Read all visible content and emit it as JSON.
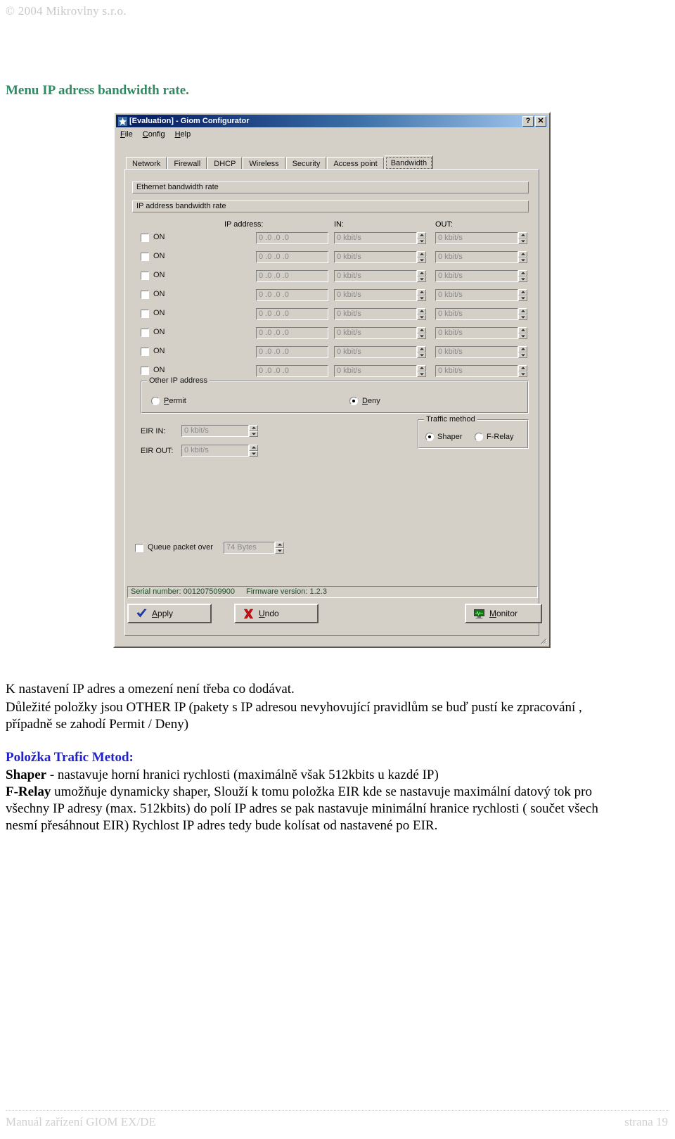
{
  "page": {
    "copyright": "© 2004 Mikrovlny s.r.o.",
    "footer_left": "Manuál zařízení GIOM EX/DE",
    "footer_right": "strana 19",
    "heading": "Menu IP adress bandwidth rate."
  },
  "window": {
    "title": "[Evaluation] - Giom Configurator",
    "icon": "app-icon",
    "help_button": "?",
    "close_button": "✕",
    "menu": [
      {
        "label": "File",
        "mnemonic": "F"
      },
      {
        "label": "Config",
        "mnemonic": "C"
      },
      {
        "label": "Help",
        "mnemonic": "H"
      }
    ],
    "tabs": [
      {
        "label": "Network",
        "selected": false
      },
      {
        "label": "Firewall",
        "selected": false
      },
      {
        "label": "DHCP",
        "selected": false
      },
      {
        "label": "Wireless",
        "selected": false
      },
      {
        "label": "Security",
        "selected": false
      },
      {
        "label": "Access point",
        "selected": false
      },
      {
        "label": "Bandwidth",
        "selected": true
      }
    ],
    "panels": {
      "ethernet_header": "Ethernet bandwidth rate",
      "ip_header": "IP address bandwidth rate"
    },
    "columns": {
      "ip": "IP address:",
      "in": "IN:",
      "out": "OUT:"
    },
    "rows": [
      {
        "enabled_label": "ON",
        "checked": false,
        "ip": "0 .0 .0 .0",
        "in": "0 kbit/s",
        "out": "0 kbit/s"
      },
      {
        "enabled_label": "ON",
        "checked": false,
        "ip": "0 .0 .0 .0",
        "in": "0 kbit/s",
        "out": "0 kbit/s"
      },
      {
        "enabled_label": "ON",
        "checked": false,
        "ip": "0 .0 .0 .0",
        "in": "0 kbit/s",
        "out": "0 kbit/s"
      },
      {
        "enabled_label": "ON",
        "checked": false,
        "ip": "0 .0 .0 .0",
        "in": "0 kbit/s",
        "out": "0 kbit/s"
      },
      {
        "enabled_label": "ON",
        "checked": false,
        "ip": "0 .0 .0 .0",
        "in": "0 kbit/s",
        "out": "0 kbit/s"
      },
      {
        "enabled_label": "ON",
        "checked": false,
        "ip": "0 .0 .0 .0",
        "in": "0 kbit/s",
        "out": "0 kbit/s"
      },
      {
        "enabled_label": "ON",
        "checked": false,
        "ip": "0 .0 .0 .0",
        "in": "0 kbit/s",
        "out": "0 kbit/s"
      },
      {
        "enabled_label": "ON",
        "checked": false,
        "ip": "0 .0 .0 .0",
        "in": "0 kbit/s",
        "out": "0 kbit/s"
      }
    ],
    "other_ip": {
      "title": "Other IP address",
      "permit": "Permit",
      "deny": "Deny",
      "selected": "Deny"
    },
    "eir": {
      "in_label": "EIR IN:",
      "in_value": "0 kbit/s",
      "out_label": "EIR OUT:",
      "out_value": "0 kbit/s"
    },
    "traffic_method": {
      "title": "Traffic method",
      "shaper": "Shaper",
      "frelay": "F-Relay",
      "selected": "Shaper"
    },
    "queue": {
      "label": "Queue packet over",
      "checked": false,
      "value": "74 Bytes"
    },
    "status": {
      "serial_label": "Serial number: 001207509900",
      "firmware_label": "Firmware version:  1.2.3"
    },
    "buttons": {
      "apply": "Apply",
      "undo": "Undo",
      "monitor": "Monitor"
    }
  },
  "body": {
    "p1": "K nastavení IP adres a omezení není třeba co dodávat.",
    "p2": "Důležité položky jsou OTHER IP (pakety s IP adresou nevyhovující pravidlům se buď  pustí ke zpracování ,",
    "p3": "případně se zahodí Permit / Deny)",
    "blue_heading": "Položka Trafic Metod:",
    "l1_bold": "Shaper",
    "l1_rest": " - nastavuje horní hranici rychlosti (maximálně však 512kbits u kazdé IP)",
    "l2_bold": "F-Relay",
    "l2_rest": "  umožňuje dynamicky shaper, Slouží k tomu položka EIR kde se nastavuje maximální datový tok pro",
    "l3": "všechny IP adresy (max. 512kbits)  do polí IP adres se pak nastavuje minimální hranice rychlosti ( součet všech",
    "l4": "nesmí přesáhnout EIR)   Rychlost IP adres tedy bude kolísat od nastavené po EIR."
  }
}
